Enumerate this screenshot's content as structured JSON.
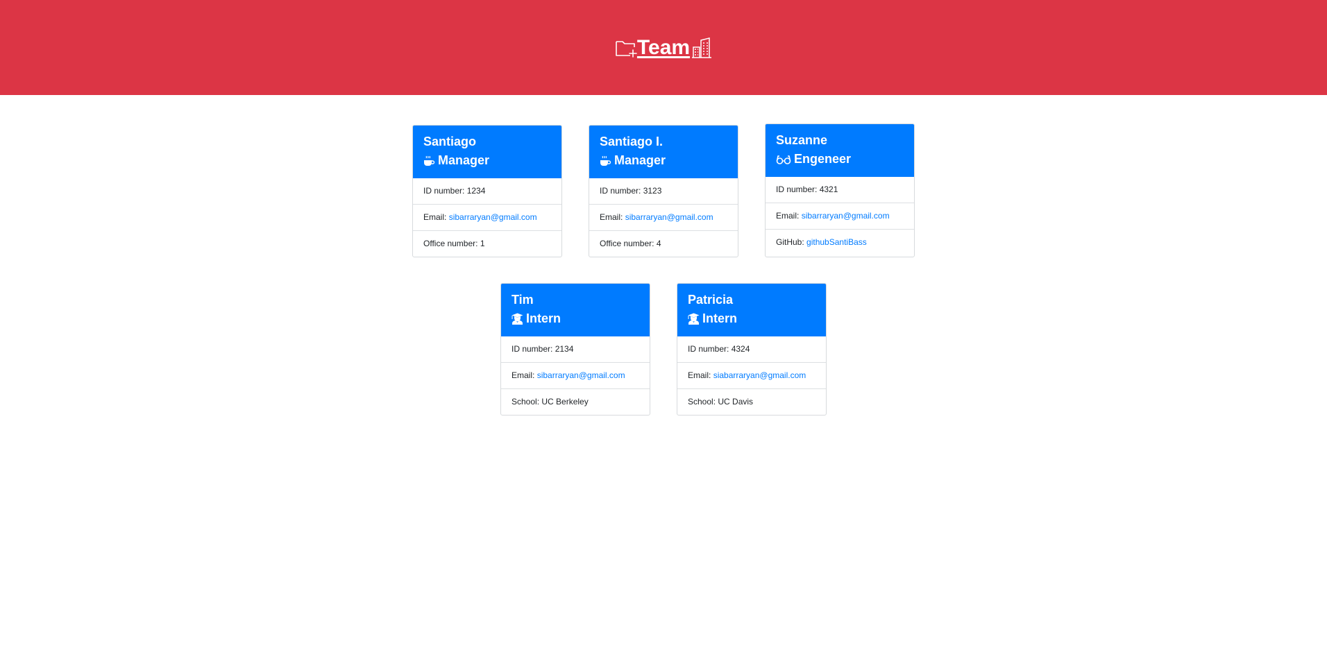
{
  "header": {
    "title": "Team",
    "icons": [
      "folder-plus-icon",
      "building-icon"
    ],
    "background": "#dc3545"
  },
  "cards": [
    {
      "name": "Santiago",
      "role": "Manager",
      "role_icon": "coffee-icon",
      "id_label": "ID number: ",
      "id": "1234",
      "email_label": "Email: ",
      "email": "sibarraryan@gmail.com",
      "extra_label": "Office number: ",
      "extra_value": "1"
    },
    {
      "name": "Santiago I.",
      "role": "Manager",
      "role_icon": "coffee-icon",
      "id_label": "ID number: ",
      "id": "3123",
      "email_label": "Email: ",
      "email": "sibarraryan@gmail.com",
      "extra_label": "Office number: ",
      "extra_value": "4"
    },
    {
      "name": "Suzanne",
      "role": "Engeneer",
      "role_icon": "glasses-icon",
      "id_label": "ID number: ",
      "id": "4321",
      "email_label": "Email: ",
      "email": "sibarraryan@gmail.com",
      "extra_label": "GitHub: ",
      "extra_value": "githubSantiBass"
    },
    {
      "name": "Tim",
      "role": "Intern",
      "role_icon": "graduate-icon",
      "id_label": "ID number: ",
      "id": "2134",
      "email_label": "Email: ",
      "email": "sibarraryan@gmail.com",
      "extra_label": "School: ",
      "extra_value": "UC Berkeley"
    },
    {
      "name": "Patricia",
      "role": "Intern",
      "role_icon": "graduate-icon",
      "id_label": "ID number: ",
      "id": "4324",
      "email_label": "Email: ",
      "email": "siabarraryan@gmail.com",
      "extra_label": "School: ",
      "extra_value": "UC Davis"
    }
  ],
  "colors": {
    "card_header": "#007bff",
    "link": "#007bff"
  }
}
